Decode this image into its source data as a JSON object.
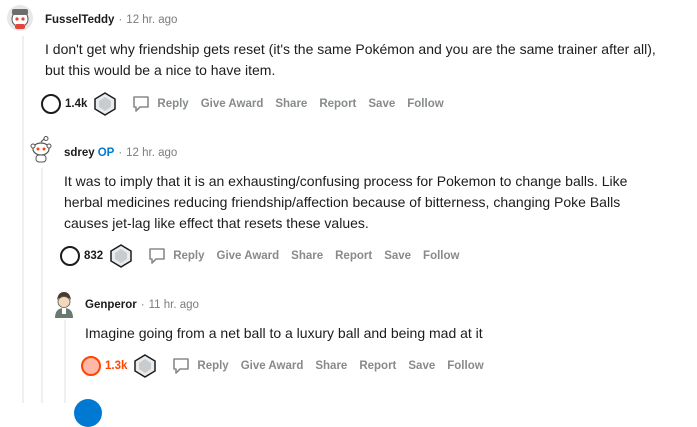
{
  "comments": [
    {
      "username": "FusselTeddy",
      "op_badge": "",
      "time": "12 hr. ago",
      "body": [
        "I don't get why friendship gets reset (it's the same Pokémon and you are the same trainer after all),",
        "but this would be a nice to have item."
      ],
      "score": "1.4k",
      "actions": {
        "reply": "Reply",
        "award": "Give Award",
        "share": "Share",
        "report": "Report",
        "save": "Save",
        "follow": "Follow"
      }
    },
    {
      "username": "sdrey",
      "op_badge": "OP",
      "time": "12 hr. ago",
      "body": [
        "It was to imply that it is an exhausting/confusing process for Pokemon to change balls. Like",
        "herbal medicines reducing friendship/affection because of bitterness, changing Poke Balls",
        "causes jet-lag like effect that resets these values."
      ],
      "score": "832",
      "actions": {
        "reply": "Reply",
        "award": "Give Award",
        "share": "Share",
        "report": "Report",
        "save": "Save",
        "follow": "Follow"
      }
    },
    {
      "username": "Genperor",
      "op_badge": "",
      "time": "11 hr. ago",
      "body": [
        "Imagine going from a net ball to a luxury ball and being mad at it"
      ],
      "score": "1.3k",
      "actions": {
        "reply": "Reply",
        "award": "Give Award",
        "share": "Share",
        "report": "Report",
        "save": "Save",
        "follow": "Follow"
      }
    }
  ],
  "colors": {
    "op": "#0079d3",
    "upvote_active": "#ff4500",
    "meta": "#7c7c7c",
    "action": "#878a8c"
  }
}
